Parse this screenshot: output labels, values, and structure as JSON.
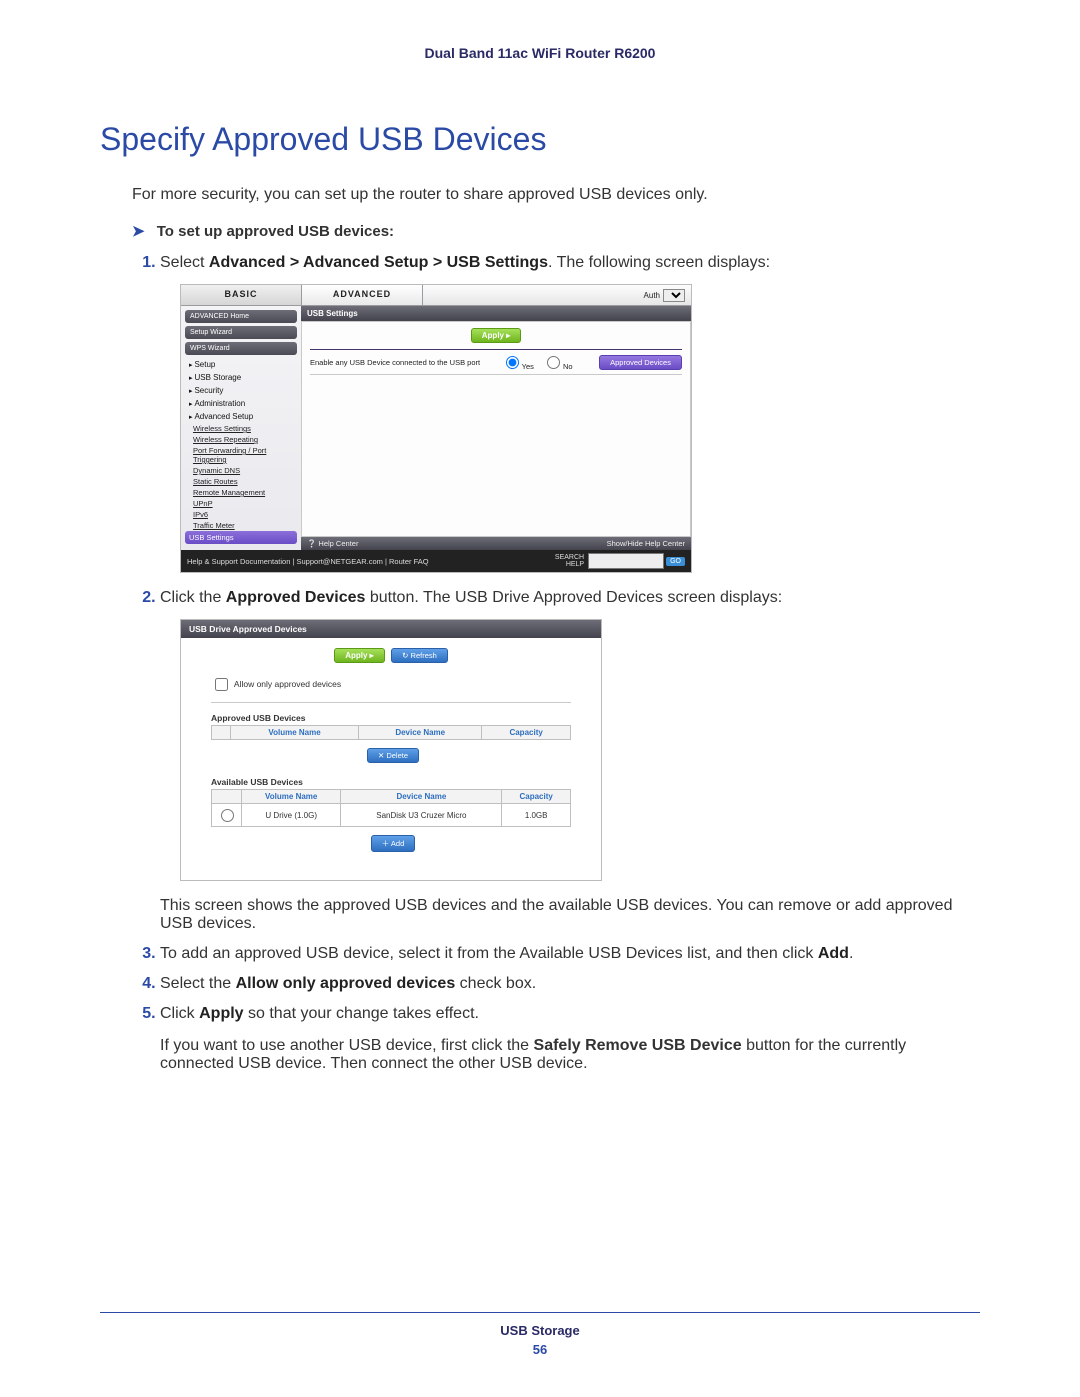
{
  "header": "Dual Band 11ac WiFi Router R6200",
  "title": "Specify Approved USB Devices",
  "intro": "For more security, you can set up the router to share approved USB devices only.",
  "task_heading": "To set up approved USB devices:",
  "steps": {
    "s1_a": "Select ",
    "s1_b": "Advanced > Advanced Setup > USB Settings",
    "s1_c": ". The following screen displays:",
    "s2_a": "Click the ",
    "s2_b": "Approved Devices",
    "s2_c": " button. The USB Drive Approved Devices screen displays:",
    "s2_para": "This screen shows the approved USB devices and the available USB devices. You can remove or add approved USB devices.",
    "s3_a": "To add an approved USB device, select it from the Available USB Devices list, and then click ",
    "s3_b": "Add",
    "s3_c": ".",
    "s4_a": "Select the ",
    "s4_b": "Allow only approved devices",
    "s4_c": " check box.",
    "s5_a": "Click ",
    "s5_b": "Apply",
    "s5_c": " so that your change takes effect."
  },
  "closing_a": "If you want to use another USB device, first click the ",
  "closing_b": "Safely Remove USB Device",
  "closing_c": " button for the currently connected USB device. Then connect the other USB device.",
  "footer_label": "USB Storage",
  "footer_page": "56",
  "shot1": {
    "tab_basic": "BASIC",
    "tab_advanced": "ADVANCED",
    "auth_label": "Auth",
    "side_buttons": [
      "ADVANCED Home",
      "Setup Wizard",
      "WPS Wizard"
    ],
    "side_items": [
      "Setup",
      "USB Storage",
      "Security",
      "Administration",
      "Advanced Setup"
    ],
    "adv_sub": [
      "Wireless Settings",
      "Wireless Repeating",
      "Port Forwarding / Port Triggering",
      "Dynamic DNS",
      "Static Routes",
      "Remote Management",
      "UPnP",
      "IPv6",
      "Traffic Meter",
      "USB Settings"
    ],
    "panel_title": "USB Settings",
    "apply_btn": "Apply ▸",
    "row_label": "Enable any USB Device connected to the USB port",
    "row_yes": "Yes",
    "row_no": "No",
    "row_btn": "Approved Devices",
    "helpbar_left": "❔ Help Center",
    "helpbar_right": "Show/Hide Help Center",
    "foot_left": "Help & Support  Documentation  |  Support@NETGEAR.com  |  Router FAQ",
    "foot_search1": "SEARCH",
    "foot_search2": "HELP",
    "foot_go": "GO"
  },
  "shot2": {
    "title": "USB Drive Approved Devices",
    "apply": "Apply ▸",
    "refresh": "↻ Refresh",
    "checkbox": "Allow only approved devices",
    "approved_heading": "Approved USB Devices",
    "th_vol": "Volume Name",
    "th_dev": "Device Name",
    "th_cap": "Capacity",
    "delete_btn": "✕ Delete",
    "available_heading": "Available USB Devices",
    "avail_row": {
      "vol": "U Drive (1.0G)",
      "dev": "SanDisk U3 Cruzer Micro",
      "cap": "1.0GB"
    },
    "add_btn": "＋ Add"
  }
}
